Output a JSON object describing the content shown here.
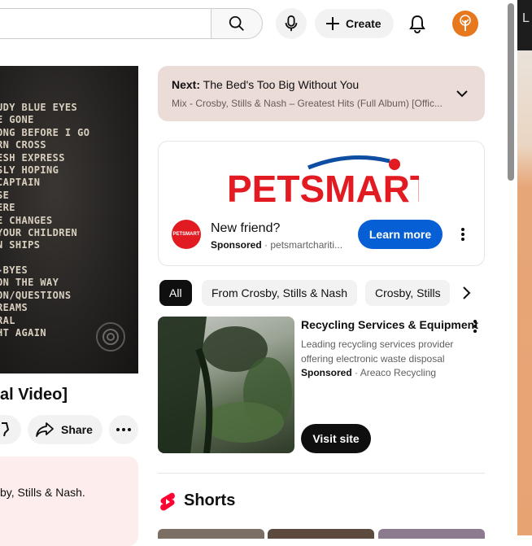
{
  "header": {
    "create_label": "Create",
    "icons": [
      "search-icon",
      "mic-icon",
      "plus-icon",
      "bell-icon",
      "avatar"
    ]
  },
  "video": {
    "tracklist": [
      "UDY BLUE EYES",
      "E GONE",
      "ONG BEFORE I GO",
      "RN CROSS",
      "ESH EXPRESS",
      "SLY HOPING",
      " CAPTAIN",
      "SE",
      "ERE",
      "E CHANGES",
      "YOUR CHILDREN",
      "N SHIPS",
      "",
      "-BYES",
      " ON THE WAY",
      "ON/QUESTIONS",
      "REAMS",
      "RAL",
      "HT AGAIN"
    ],
    "title": "al Video]",
    "share_label": "Share",
    "description": "by, Stills & Nash."
  },
  "next_up": {
    "prefix": "Next:",
    "title": "The Bed's Too Big Without You",
    "subtitle": "Mix - Crosby, Stills & Nash – Greatest Hits (Full Album) [Offic..."
  },
  "ad": {
    "brand_logo_text": "PETSMART",
    "icon_text": "PETSMART",
    "title": "New friend?",
    "sponsored_label": "Sponsored",
    "advertiser": "petsmartchariti...",
    "cta_label": "Learn more",
    "colors": {
      "brand_red": "#e21a22",
      "brand_blue": "#0d4ea3",
      "cta_blue": "#065fd4"
    }
  },
  "chips": [
    {
      "label": "All",
      "active": true
    },
    {
      "label": "From Crosby, Stills & Nash",
      "active": false
    },
    {
      "label": "Crosby, Stills",
      "active": false
    }
  ],
  "sponsored_item": {
    "title": "Recycling Services & Equipment",
    "description": "Leading recycling services provider offering electronic waste disposal",
    "sponsored_label": "Sponsored",
    "advertiser": "Areaco Recycling",
    "cta_label": "Visit site"
  },
  "shorts": {
    "title": "Shorts"
  },
  "edge_letter": "L"
}
